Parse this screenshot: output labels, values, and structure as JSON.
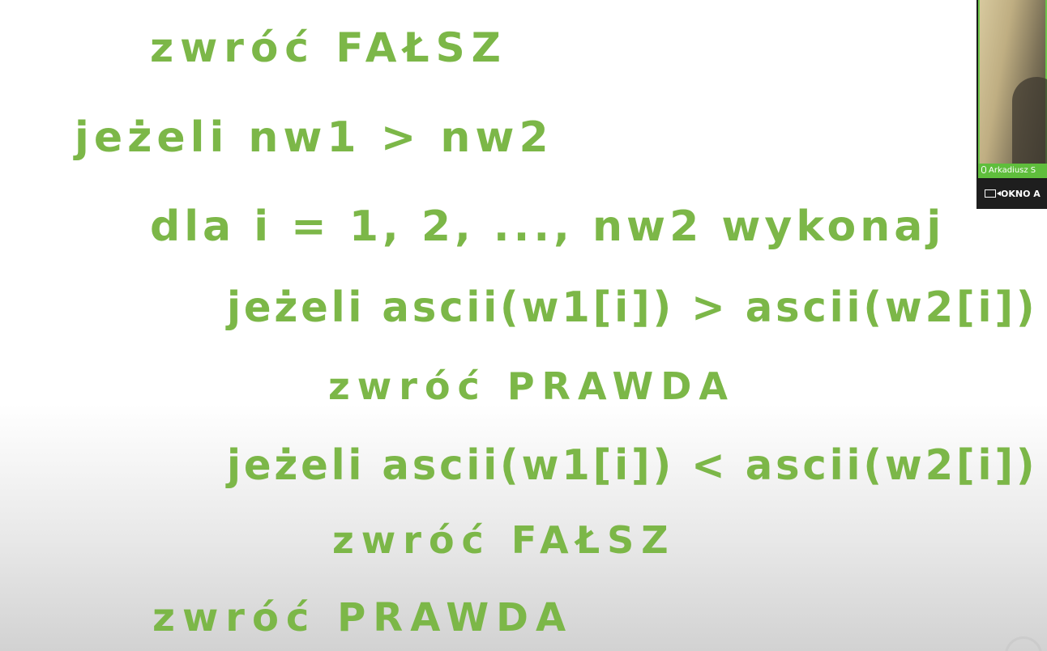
{
  "board": {
    "lines": [
      "zwróć FAŁSZ",
      "jeżeli nw1 > nw2",
      "dla i = 1, 2, ..., nw2 wykonaj",
      "jeżeli ascii(w1[i]) > ascii(w2[i])",
      "zwróć PRAWDA",
      "jeżeli ascii(w1[i]) < ascii(w2[i])",
      "zwróć FAŁSZ",
      "zwróć PRAWDA"
    ],
    "ink_color": "#7cb748"
  },
  "video": {
    "speaker_name": "Arkadiusz S",
    "window_button_label": "OKNO A",
    "highlight_color": "#5fbe3c"
  }
}
